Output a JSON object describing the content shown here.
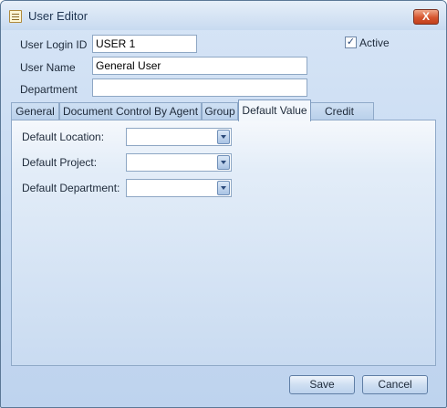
{
  "window": {
    "title": "User Editor",
    "close_label": "X"
  },
  "form": {
    "login_label": "User Login ID",
    "login_value": "USER 1",
    "active_label": "Active",
    "active_checked": true,
    "name_label": "User Name",
    "name_value": "General User",
    "department_label": "Department",
    "department_value": ""
  },
  "tabs": [
    {
      "label": "General"
    },
    {
      "label": "Document Control By Agent"
    },
    {
      "label": "Group"
    },
    {
      "label": "Default Value",
      "active": true
    },
    {
      "label": "Credit Control"
    }
  ],
  "defaults": {
    "location_label": "Default Location:",
    "location_value": "",
    "project_label": "Default Project:",
    "project_value": "",
    "department_label": "Default Department:",
    "department_value": ""
  },
  "buttons": {
    "save": "Save",
    "cancel": "Cancel"
  },
  "icons": {
    "app": "document-edit-icon",
    "close": "close-icon",
    "check": "checkmark-icon",
    "dropdown": "chevron-down-icon"
  }
}
